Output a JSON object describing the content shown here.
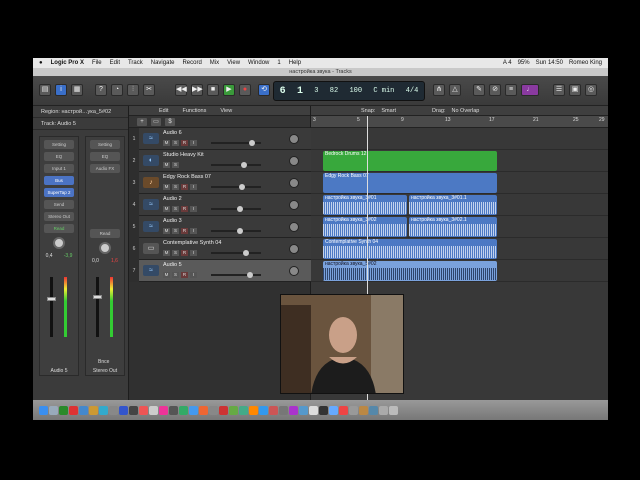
{
  "menubar": {
    "apple": "",
    "app": "Logic Pro X",
    "items": [
      "File",
      "Edit",
      "Track",
      "Navigate",
      "Record",
      "Mix",
      "View",
      "Window",
      "1",
      "Help"
    ],
    "status": {
      "battery": "95%",
      "time": "Sun 14:50",
      "user": "Romeo King",
      "flag": "A 4"
    }
  },
  "window": {
    "title": "настройка звука - Tracks"
  },
  "lcd": {
    "bar": "6",
    "beat": "1",
    "pos3": "3",
    "tempo": "82",
    "tempo2": "100",
    "key": "C min",
    "sig": "4/4"
  },
  "inspector": {
    "region": "Region: настрой…ука_5#02",
    "track": "Track: Audio 5",
    "strip1": {
      "setting": "Setting",
      "eq": "EQ",
      "input": "Input 1",
      "bus": "Bus",
      "plugin": "SuperTap 2",
      "send": "Send",
      "out": "Stereo Out",
      "read": "Read",
      "val1": "0,4",
      "val2": "-3,9",
      "name": "Audio 5"
    },
    "strip2": {
      "setting": "Setting",
      "eq": "EQ",
      "audiofx": "Audio FX",
      "read": "Read",
      "val1": "0,0",
      "val2": "1,6",
      "bnce": "Bnce",
      "name": "Stereo Out"
    }
  },
  "headers": {
    "edit": "Edit",
    "functions": "Functions",
    "view": "View",
    "plus": "+",
    "tracks": [
      {
        "num": "1",
        "name": "Audio 6",
        "icon": "≈"
      },
      {
        "num": "2",
        "name": "Studio Heavy Kit",
        "icon": "◐"
      },
      {
        "num": "3",
        "name": "Edgy Rock Bass 07",
        "icon": "♪"
      },
      {
        "num": "4",
        "name": "Audio 2",
        "icon": "≈"
      },
      {
        "num": "5",
        "name": "Audio 3",
        "icon": "≈"
      },
      {
        "num": "6",
        "name": "Contemplative Synth 04",
        "icon": "▭"
      },
      {
        "num": "7",
        "name": "Audio 5",
        "icon": "≈"
      }
    ],
    "btn": {
      "m": "M",
      "s": "S",
      "r": "R",
      "i": "I"
    }
  },
  "arrange": {
    "snap_label": "Snap:",
    "snap": "Smart",
    "drag_label": "Drag:",
    "drag": "No Overlap",
    "ruler": [
      "3",
      "5",
      "9",
      "13",
      "17",
      "21",
      "25",
      "29"
    ],
    "regions": [
      {
        "lane": 1,
        "name": "Bedrock Drums 12",
        "type": "midi"
      },
      {
        "lane": 2,
        "name": "Edgy Rock Bass 07",
        "type": "audio"
      },
      {
        "lane": 3,
        "name": "настройка звука_3#01",
        "type": "audio"
      },
      {
        "lane": 3,
        "name": "настройка звука_3#01.1",
        "type": "audio"
      },
      {
        "lane": 4,
        "name": "настройка звука_3#02",
        "type": "audio"
      },
      {
        "lane": 4,
        "name": "настройка звука_3#02.1",
        "type": "audio"
      },
      {
        "lane": 5,
        "name": "Contemplative Synth 04",
        "type": "audio"
      },
      {
        "lane": 6,
        "name": "настройка звука_5#02",
        "type": "audio"
      }
    ]
  },
  "colors": {
    "accent": "#3a6fc9",
    "midi": "#38a83c",
    "audio": "#4c79c4"
  }
}
